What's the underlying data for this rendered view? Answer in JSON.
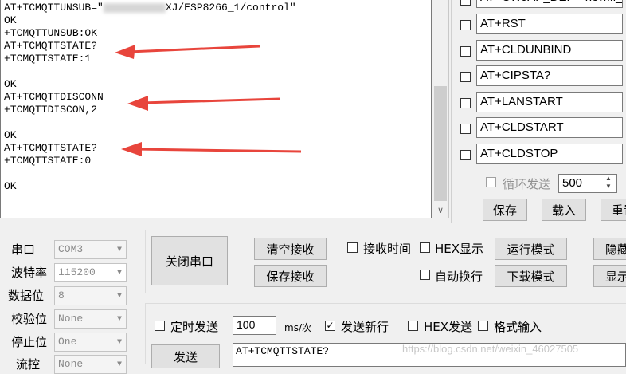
{
  "receive_lines": [
    {
      "pre": "AT+TCMQTTUNSUB=\"",
      "post": "XJ/ESP8266_1/control\"",
      "redacted": true
    },
    {
      "text": "OK"
    },
    {
      "text": "+TCMQTTUNSUB:OK"
    },
    {
      "text": "AT+TCMQTTSTATE?"
    },
    {
      "text": "+TCMQTTSTATE:1"
    },
    {
      "text": ""
    },
    {
      "text": "OK"
    },
    {
      "text": "AT+TCMQTTDISCONN"
    },
    {
      "text": "+TCMQTTDISCON,2"
    },
    {
      "text": ""
    },
    {
      "text": "OK"
    },
    {
      "text": "AT+TCMQTTSTATE?"
    },
    {
      "text": "+TCMQTTSTATE:0"
    },
    {
      "text": ""
    },
    {
      "text": "OK"
    }
  ],
  "commands": [
    "AT+CWJAP_DEF=\"newifi_",
    "AT+RST",
    "AT+CLDUNBIND",
    "AT+CIPSTA?",
    "AT+LANSTART",
    "AT+CLDSTART",
    "AT+CLDSTOP"
  ],
  "loop_send": {
    "label": "循环发送",
    "interval": "500"
  },
  "right_buttons": {
    "save": "保存",
    "load": "载入",
    "reset": "重置"
  },
  "port_settings": [
    {
      "label": "串口",
      "value": "COM3"
    },
    {
      "label": "波特率",
      "value": "115200"
    },
    {
      "label": "数据位",
      "value": "8"
    },
    {
      "label": "校验位",
      "value": "None"
    },
    {
      "label": "停止位",
      "value": "One"
    },
    {
      "label": "流控",
      "value": "None"
    }
  ],
  "buttons": {
    "close_port": "关闭串口",
    "clear_recv": "清空接收",
    "save_recv": "保存接收",
    "run_mode": "运行模式",
    "download_mode": "下载模式",
    "hide": "隐藏",
    "show": "显示",
    "send": "发送"
  },
  "recv_options": {
    "recv_time": "接收时间",
    "hex_display": "HEX显示",
    "auto_wrap": "自动换行"
  },
  "send_options": {
    "timed_send": "定时发送",
    "period": "100",
    "unit": "ms/次",
    "send_newline": "发送新行",
    "hex_send": "HEX发送",
    "format_input": "格式输入"
  },
  "send_text": "AT+TCMQTTSTATE?",
  "watermark": "https://blog.csdn.net/weixin_46027505",
  "colors": {
    "arrow": "#e8453c"
  }
}
